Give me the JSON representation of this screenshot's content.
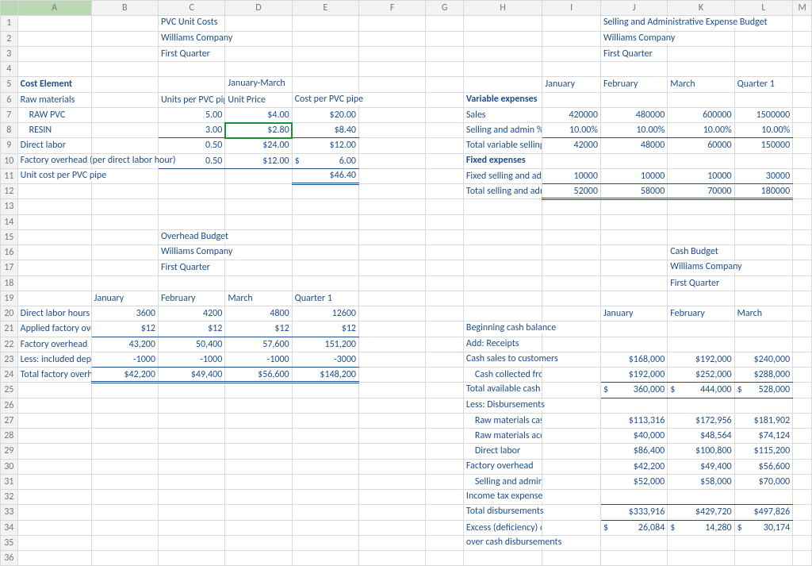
{
  "cols": [
    "",
    "A",
    "B",
    "C",
    "D",
    "E",
    "F",
    "G",
    "H",
    "I",
    "J",
    "K",
    "L",
    "M"
  ],
  "pvc": {
    "title": "PVC Unit Costs",
    "company": "Williams Company",
    "period": "First Quarter"
  },
  "sna": {
    "title": "Selling and Administrative Expense Budget",
    "company": "Williams Company",
    "period": "First Quarter"
  },
  "seclabels": {
    "cost_element": "Cost Element",
    "jan_mar": "January-March",
    "units": "Units per PVC pipe",
    "unit_price": "Unit Price",
    "cost_per": "Cost per PVC pipe",
    "raw_mat": "Raw materials",
    "raw_pvc": "RAW PVC",
    "resin": "RESIN",
    "direct_labor": "Direct labor",
    "foh": "Factory overhead (per direct labor hour)",
    "unit_cost": "Unit cost per PVC pipe",
    "var_exp": "Variable expenses",
    "sales": "Sales",
    "sell_adm_pct": "Selling and admin %",
    "tot_var": "Total variable selling",
    "fix_exp": "Fixed expenses",
    "fix_sell": "Fixed selling and admin",
    "tot_sell": "Total selling and admin"
  },
  "months": {
    "jan": "January",
    "feb": "February",
    "mar": "March",
    "q1": "Quarter 1"
  },
  "pvc_rows": {
    "raw_pvc": {
      "u": "5.00",
      "p": "$4.00",
      "c": "$20.00"
    },
    "resin": {
      "u": "3.00",
      "p": "$2.80",
      "c": "$8.40"
    },
    "dl": {
      "u": "0.50",
      "p": "$24.00",
      "c": "$12.00"
    },
    "foh": {
      "u": "0.50",
      "p": "$12.00",
      "c_pre": "$",
      "c": "6.00"
    },
    "total": "$46.40"
  },
  "sna_rows": {
    "sales": {
      "i": "420000",
      "j": "480000",
      "k": "600000",
      "l": "1500000"
    },
    "pct": {
      "i": "10.00%",
      "j": "10.00%",
      "k": "10.00%",
      "l": "10.00%"
    },
    "tv": {
      "i": "42000",
      "j": "48000",
      "k": "60000",
      "l": "150000"
    },
    "fix": {
      "i": "10000",
      "j": "10000",
      "k": "10000",
      "l": "30000"
    },
    "tot": {
      "i": "52000",
      "j": "58000",
      "k": "70000",
      "l": "180000"
    }
  },
  "oh": {
    "title": "Overhead Budget",
    "company": "Williams Company",
    "period": "First Quarter",
    "labels": {
      "dlh": "Direct labor hours",
      "rate": "Applied factory overhead rate",
      "foh": "Factory overhead",
      "less": "Less: included depreciation",
      "tot": "Total factory overhead cash"
    },
    "dlh": {
      "b": "3600",
      "c": "4200",
      "d": "4800",
      "e": "12600"
    },
    "rate": {
      "b": "$12",
      "c": "$12",
      "d": "$12",
      "e": "$12"
    },
    "foh": {
      "b": "43,200",
      "c": "50,400",
      "d": "57,600",
      "e": "151,200"
    },
    "less": {
      "b": "-1000",
      "c": "-1000",
      "d": "-1000",
      "e": "-3000"
    },
    "tot": {
      "b": "$42,200",
      "c": "$49,400",
      "d": "$56,600",
      "e": "$148,200"
    }
  },
  "cash": {
    "title": "Cash Budget",
    "company": "Williams Company",
    "period": "First Quarter",
    "labels": {
      "beg": "Beginning cash balance",
      "add": "Add: Receipts",
      "cs": "Cash sales to customers",
      "cc": "Cash collected from accounts receivable",
      "tac": "Total available cash",
      "less": "Less: Disbursements",
      "rmcp": "Raw materials cash purchases",
      "rmap": "Raw materials accounts payable",
      "dl": "Direct labor",
      "foh": "Factory overhead",
      "sae": "Selling and administrative expense",
      "ite": "Income tax expense",
      "td": "Total disbursements",
      "exc": "Excess (deficiency) of available cash",
      "over": "over cash disbursements"
    },
    "cs": {
      "j": "$168,000",
      "k": "$192,000",
      "l": "$240,000"
    },
    "cc": {
      "j": "$192,000",
      "k": "$252,000",
      "l": "$288,000"
    },
    "tac": {
      "jp": "$",
      "j": "360,000",
      "kp": "$",
      "k": "444,000",
      "lp": "$",
      "l": "528,000"
    },
    "rmcp": {
      "j": "$113,316",
      "k": "$172,956",
      "l": "$181,902"
    },
    "rmap": {
      "j": "$40,000",
      "k": "$48,564",
      "l": "$74,124"
    },
    "dl": {
      "j": "$86,400",
      "k": "$100,800",
      "l": "$115,200"
    },
    "foh": {
      "j": "$42,200",
      "k": "$49,400",
      "l": "$56,600"
    },
    "sae": {
      "j": "$52,000",
      "k": "$58,000",
      "l": "$70,000"
    },
    "td": {
      "j": "$333,916",
      "k": "$429,720",
      "l": "$497,826"
    },
    "exc": {
      "jp": "$",
      "j": "26,084",
      "kp": "$",
      "k": "14,280",
      "lp": "$",
      "l": "30,174"
    }
  }
}
